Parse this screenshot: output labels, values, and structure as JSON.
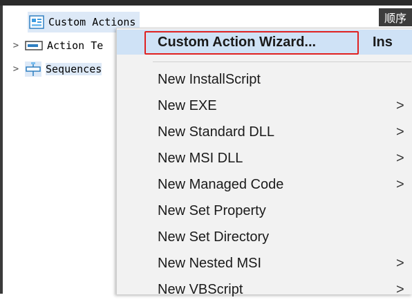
{
  "tree": {
    "items": [
      {
        "label": "Custom Actions",
        "icon": "custom-actions-icon"
      },
      {
        "label": "Action Te",
        "icon": "action-text-icon",
        "expander": ">"
      },
      {
        "label": "Sequences",
        "icon": "sequences-icon",
        "expander": ">"
      }
    ]
  },
  "header": {
    "right_text": "顺序"
  },
  "context_menu": {
    "items": [
      {
        "label": "Custom Action Wizard...",
        "shortcut": "Ins",
        "highlighted": true
      },
      {
        "label": "New InstallScript",
        "submenu": false
      },
      {
        "label": "New EXE",
        "submenu": true
      },
      {
        "label": "New Standard DLL",
        "submenu": true
      },
      {
        "label": "New MSI DLL",
        "submenu": true
      },
      {
        "label": "New Managed Code",
        "submenu": true
      },
      {
        "label": "New Set Property",
        "submenu": false
      },
      {
        "label": "New Set Directory",
        "submenu": false
      },
      {
        "label": "New Nested MSI",
        "submenu": true
      },
      {
        "label": "New VBScript",
        "submenu": true
      }
    ],
    "arrow_glyph": ">"
  },
  "colors": {
    "highlight": "#cfe2f6",
    "red_outline": "#e02020",
    "menu_bg": "#f2f2f2"
  }
}
